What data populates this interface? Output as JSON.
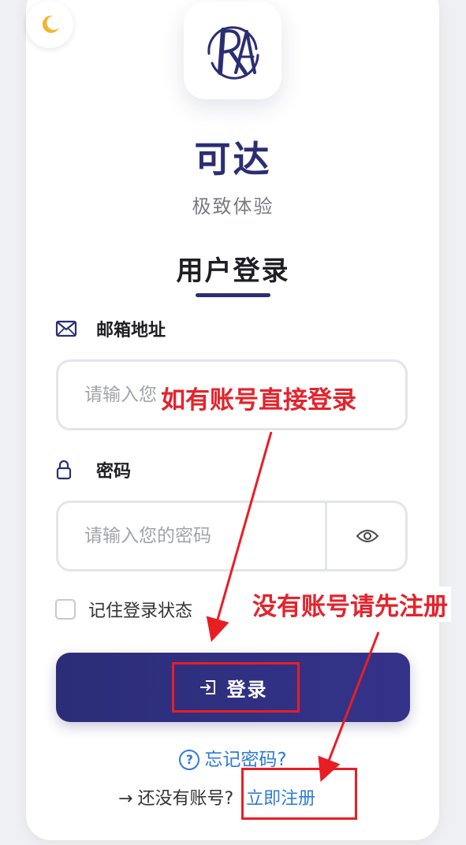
{
  "brand": {
    "title": "可达",
    "subtitle": "极致体验",
    "logo_icon": "ka-monogram-logo",
    "color": "#2b2e73"
  },
  "theme_toggle": {
    "icon": "moon-icon"
  },
  "login_form": {
    "heading": "用户登录",
    "email": {
      "label": "邮箱地址",
      "icon": "mail-icon",
      "placeholder": "请输入您的邮箱地址",
      "value": ""
    },
    "password": {
      "label": "密码",
      "icon": "lock-icon",
      "placeholder": "请输入您的密码",
      "value": "",
      "toggle_icon": "eye-icon"
    },
    "remember_label": "记住登录状态",
    "remember_checked": false,
    "submit_label": "登录",
    "submit_icon": "login-icon",
    "forgot_label": "忘记密码?",
    "register_prompt": "还没有账号?",
    "register_link": "立即注册"
  },
  "annotations": {
    "login_hint": "如有账号直接登录",
    "register_hint": "没有账号请先注册",
    "color": "#e4232b"
  }
}
